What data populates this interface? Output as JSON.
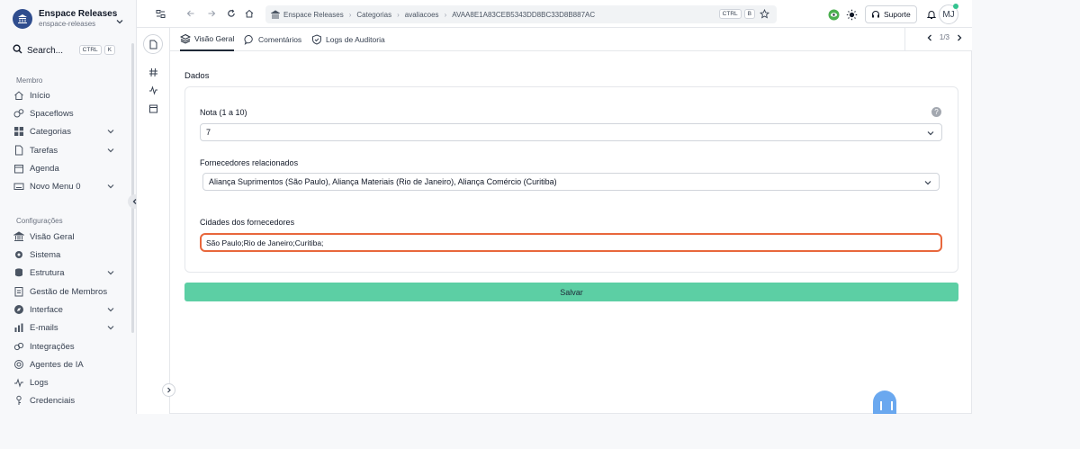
{
  "workspace": {
    "name": "Enspace Releases",
    "slug": "enspace-releases"
  },
  "search": {
    "label": "Search...",
    "shortcut": [
      "CTRL",
      "K"
    ]
  },
  "sidebar": {
    "section_member": "Membro",
    "member_items": [
      {
        "label": "Início",
        "icon": "home-icon"
      },
      {
        "label": "Spaceflows",
        "icon": "flow-icon"
      },
      {
        "label": "Categorias",
        "icon": "grid-icon"
      },
      {
        "label": "Tarefas",
        "icon": "file-icon"
      },
      {
        "label": "Agenda",
        "icon": "calendar-icon"
      },
      {
        "label": "Novo Menu 0",
        "icon": "keyboard-icon"
      }
    ],
    "section_config": "Configurações",
    "config_items": [
      {
        "label": "Visão Geral",
        "icon": "bank-icon"
      },
      {
        "label": "Sistema",
        "icon": "gear-icon"
      },
      {
        "label": "Estrutura",
        "icon": "database-icon"
      },
      {
        "label": "Gestão de Membros",
        "icon": "clipboard-icon"
      },
      {
        "label": "Interface",
        "icon": "compass-icon"
      },
      {
        "label": "E-mails",
        "icon": "chart-icon"
      },
      {
        "label": "Integrações",
        "icon": "link-icon"
      },
      {
        "label": "Agentes de IA",
        "icon": "robot-icon"
      },
      {
        "label": "Logs",
        "icon": "pulse-icon"
      },
      {
        "label": "Credenciais",
        "icon": "key-icon"
      }
    ]
  },
  "breadcrumb": {
    "items": [
      "Enspace Releases",
      "Categorias",
      "avaliacoes",
      "AVAA8E1A83CEB5343DD8BC33D8B887AC"
    ],
    "shortcut": [
      "CTRL",
      "B"
    ]
  },
  "topbar": {
    "support_label": "Suporte",
    "avatar_initials": "MJ"
  },
  "tabs": [
    {
      "label": "Visão Geral",
      "icon": "layers-icon"
    },
    {
      "label": "Comentários",
      "icon": "comment-icon"
    },
    {
      "label": "Logs de Auditoria",
      "icon": "shield-icon"
    }
  ],
  "pager": {
    "text": "1/3"
  },
  "form": {
    "section_title": "Dados",
    "rating_label": "Nota (1 a 10)",
    "rating_value": "7",
    "suppliers_label": "Fornecedores relacionados",
    "suppliers_value": "Aliança Suprimentos (São Paulo), Aliança Materiais (Rio de Janeiro), Aliança Comércio (Curitiba)",
    "cities_label": "Cidades dos fornecedores",
    "cities_value": "São Paulo;Rio de Janeiro;Curitiba;",
    "save_label": "Salvar"
  },
  "colors": {
    "accent": "#5ccfa4",
    "highlight": "#e8673c",
    "brand": "#2f4d8e"
  }
}
